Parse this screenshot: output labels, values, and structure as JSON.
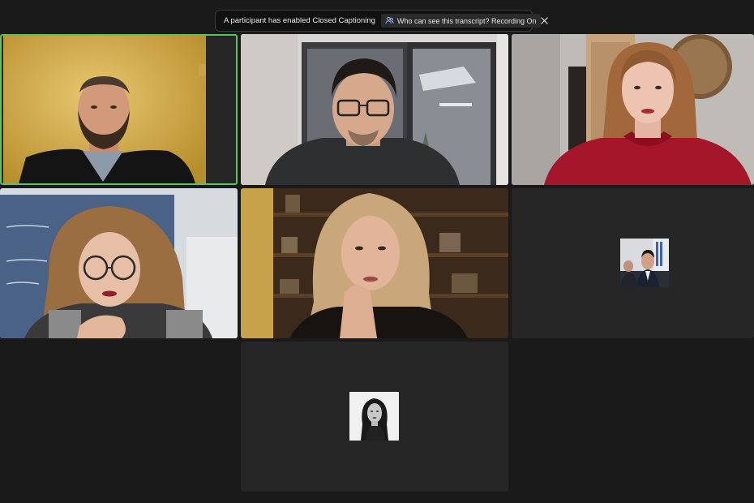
{
  "notification": {
    "message": "A participant has enabled Closed Captioning",
    "transcript_chip": "Who can see this transcript? Recording On",
    "chip_icon": "people-icon",
    "close_icon": "close-icon"
  },
  "participants": [
    {
      "id": "p1",
      "state": "video",
      "active_speaker": true,
      "scene": "man in dark suit, warm yellow wall"
    },
    {
      "id": "p2",
      "state": "video",
      "active_speaker": false,
      "scene": "man with glasses, office with window"
    },
    {
      "id": "p3",
      "state": "video",
      "active_speaker": false,
      "scene": "woman in red sweater, wooden door"
    },
    {
      "id": "p4",
      "state": "video",
      "active_speaker": false,
      "scene": "woman with glasses, chalkboard"
    },
    {
      "id": "p5",
      "state": "video",
      "active_speaker": false,
      "scene": "woman with blonde curly hair, bookshelf"
    },
    {
      "id": "p6",
      "state": "profile-picture",
      "active_speaker": false
    },
    {
      "id": "p7",
      "state": "profile-picture",
      "active_speaker": false
    }
  ],
  "colors": {
    "background": "#1a1a1a",
    "tile_dark": "#262626",
    "active_speaker_border": "#5ec15e"
  }
}
